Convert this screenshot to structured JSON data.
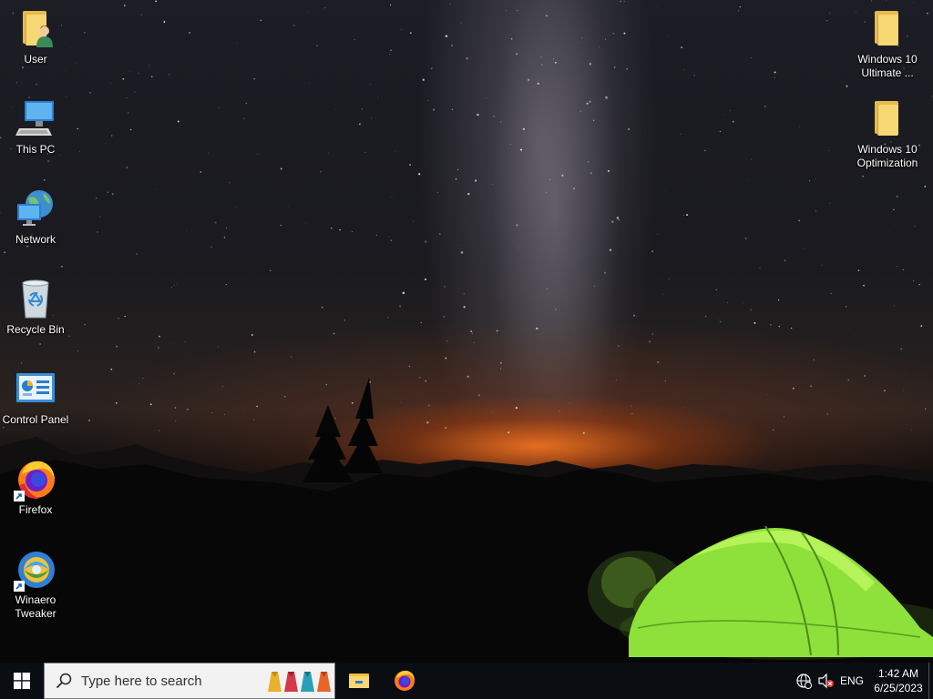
{
  "desktop": {
    "icons_left": [
      {
        "label": "User",
        "icon": "user-folder-icon"
      },
      {
        "label": "This PC",
        "icon": "computer-icon"
      },
      {
        "label": "Network",
        "icon": "network-globe-icon"
      },
      {
        "label": "Recycle Bin",
        "icon": "recycle-bin-icon"
      },
      {
        "label": "Control Panel",
        "icon": "control-panel-icon"
      },
      {
        "label": "Firefox",
        "icon": "firefox-icon"
      },
      {
        "label": "Winaero Tweaker",
        "icon": "winaero-tweaker-icon"
      }
    ],
    "icons_right": [
      {
        "label": "Windows 10 Ultimate ...",
        "icon": "folder-icon"
      },
      {
        "label": "Windows 10 Optimization",
        "icon": "folder-icon"
      }
    ]
  },
  "taskbar": {
    "search_placeholder": "Type here to search",
    "pinned": [
      {
        "name": "File Explorer",
        "icon": "file-explorer-icon"
      },
      {
        "name": "Firefox",
        "icon": "firefox-icon"
      }
    ],
    "tray": {
      "language": "ENG",
      "time": "1:42 AM",
      "date": "6/25/2023",
      "network_icon": "network-globe-icon",
      "volume_icon": "volume-muted-icon"
    }
  },
  "colors": {
    "taskbar_bg": "#0a0d12",
    "search_bg": "#f2f2f2",
    "tent_green": "#8ee03a",
    "horizon_glow": "#ff7a1e",
    "windows_logo": "#ffffff"
  }
}
